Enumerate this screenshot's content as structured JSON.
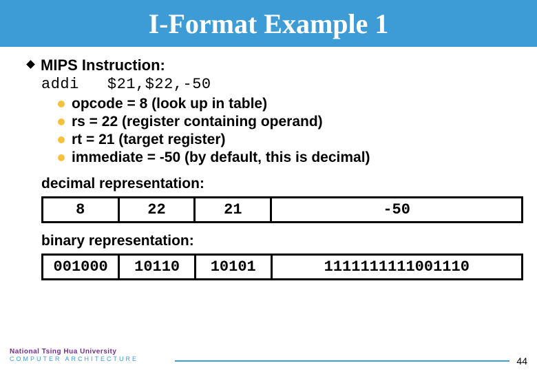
{
  "title": "I-Format Example 1",
  "heading": "MIPS Instruction:",
  "code_line": "addi   $21,$22,-50",
  "bullets": [
    "opcode = 8 (look up in table)",
    "rs = 22 (register containing operand)",
    "rt = 21 (target register)",
    "immediate = -50 (by default, this is decimal)"
  ],
  "decimal_label": "decimal representation:",
  "decimal_row": {
    "opcode": "8",
    "rs": "22",
    "rt": "21",
    "imm": "-50"
  },
  "binary_label": "binary representation:",
  "binary_row": {
    "opcode": "001000",
    "rs": "10110",
    "rt": "10101",
    "imm": "1111111111001110"
  },
  "footer": {
    "university": "National Tsing Hua University",
    "course": "COMPUTER  ARCHITECTURE",
    "page": "44"
  }
}
